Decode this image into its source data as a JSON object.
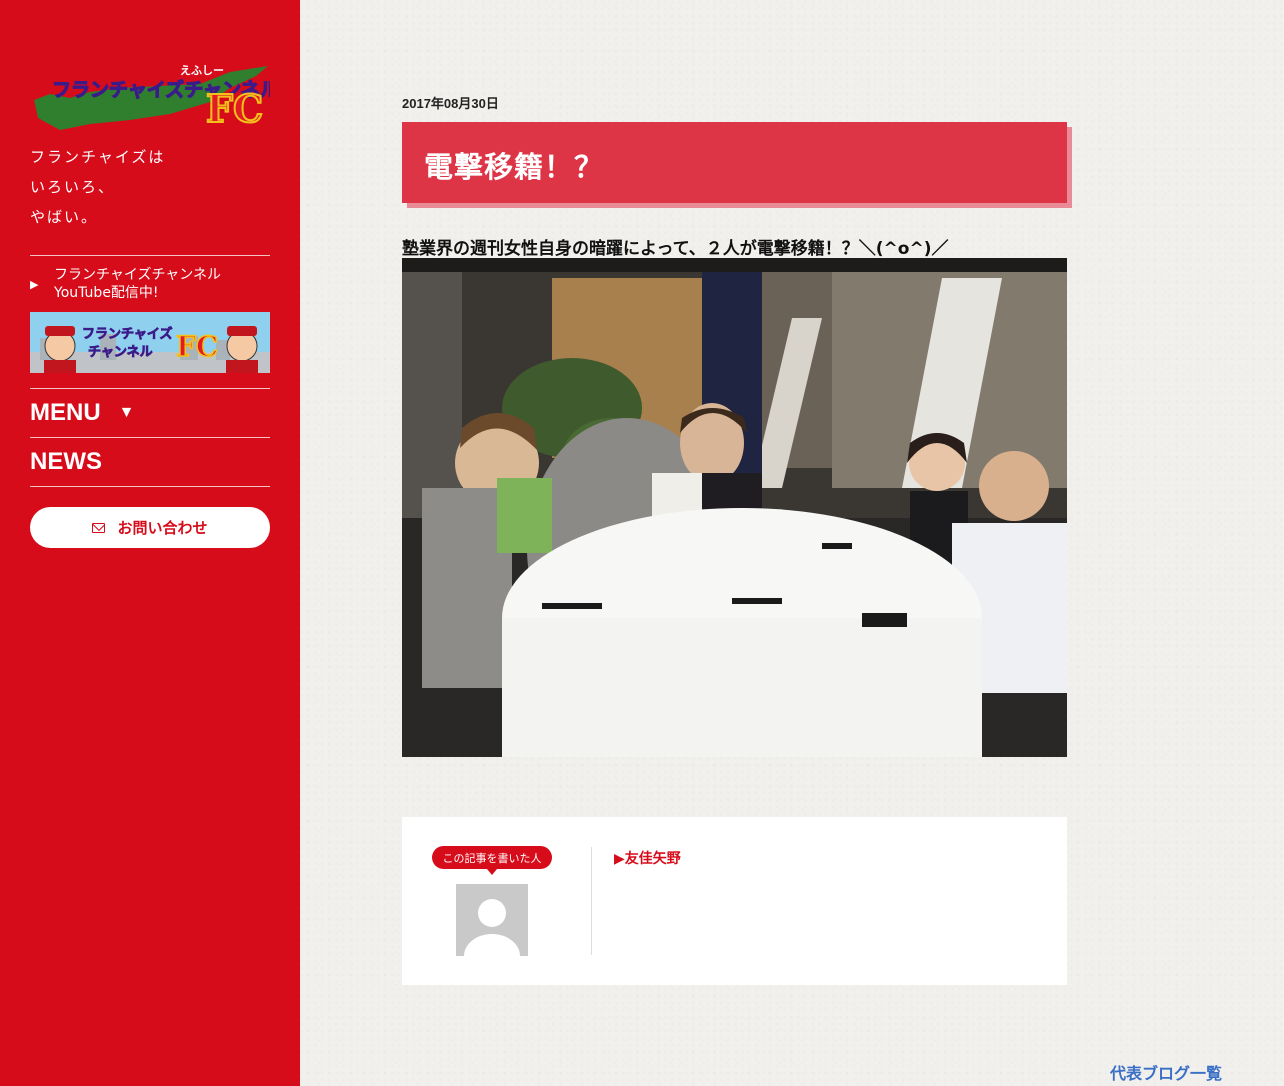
{
  "sidebar": {
    "logo": {
      "main": "フランチャイズチャンネル",
      "sub": "えふしー",
      "mark": "FC"
    },
    "tagline": [
      "フランチャイズは",
      "いろいろ、",
      "やばい。"
    ],
    "youtube_line1": "フランチャイズチャンネル",
    "youtube_line2": "YouTube配信中!",
    "banner": {
      "line1": "フランチャイズ",
      "line2": "チャンネル",
      "mark": "FC"
    },
    "menu_label": "MENU",
    "menu_arrow": "▼",
    "news_label": "NEWS",
    "contact_label": "お問い合わせ"
  },
  "article": {
    "date": "2017年08月30日",
    "title": "電撃移籍！？",
    "lead": "塾業界の週刊女性自身の暗躍によって、２人が電撃移籍！？＼(^o^)／"
  },
  "author_box": {
    "badge": "この記事を書いた人",
    "name": "▶友佳矢野"
  },
  "footer": {
    "blog_link": "代表ブログ一覧"
  },
  "colors": {
    "sidebar": "#d70c1b",
    "title_box": "#dd3446",
    "link": "#3a6fc6"
  }
}
